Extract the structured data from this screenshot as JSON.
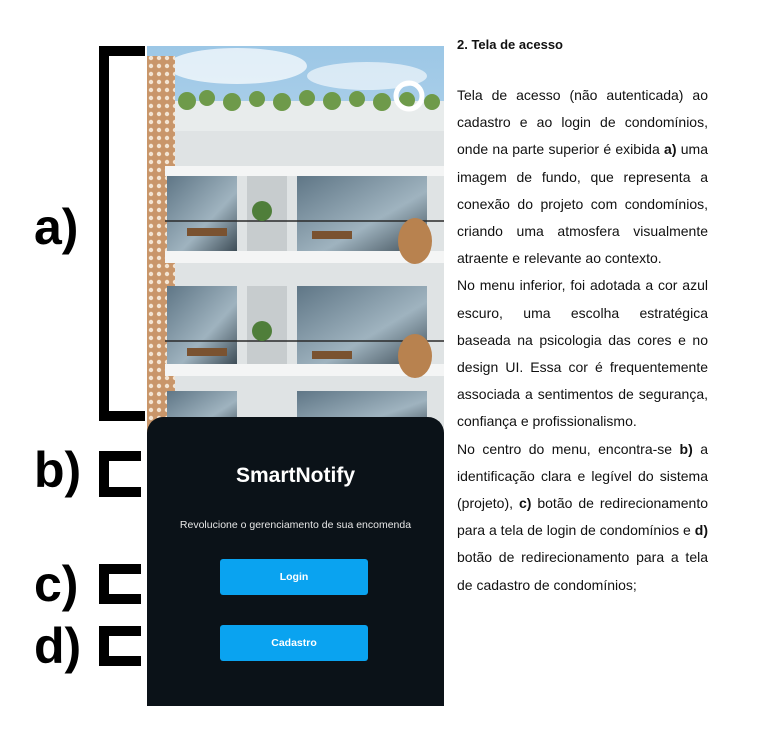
{
  "markers": {
    "a": "a)",
    "b": "b)",
    "c": "c)",
    "d": "d)"
  },
  "phone": {
    "app_title": "SmartNotify",
    "tagline": "Revolucione o gerenciamento de sua encomenda",
    "login_label": "Login",
    "signup_label": "Cadastro",
    "accent": "#0aa3f0",
    "panel_bg": "#0b1218"
  },
  "description": {
    "heading": "2. Tela de acesso",
    "p1": "Tela de acesso (não autenticada) ao cadastro e ao login de condomínios, onde na parte superior é exibida",
    "p1_bold": "a)",
    "p1_rest": "uma imagem de fundo, que representa a conexão do projeto com condomínios, criando uma atmosfera visualmente atraente e relevante ao contexto.",
    "p2": "No menu inferior, foi adotada a cor azul escuro, uma escolha estratégica baseada na psicologia das cores e no design UI. Essa cor é frequentemente associada a sentimentos de segurança, confiança e profissionalismo.",
    "p3_a": "No centro do menu, encontra-se",
    "p3_b_bold": "b)",
    "p3_b": "a identificação clara e legível do sistema (projeto),",
    "p3_c_bold": "c)",
    "p3_c": "botão de redirecionamento para a tela de login de condomínios e",
    "p3_d_bold": "d)",
    "p3_d": "botão de redirecionamento para a tela de cadastro de condomínios;"
  }
}
